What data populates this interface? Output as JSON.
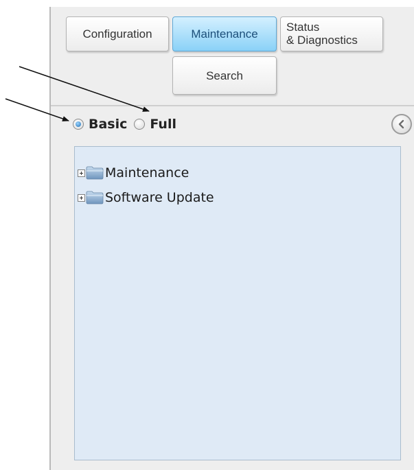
{
  "tabs": {
    "configuration": "Configuration",
    "maintenance": "Maintenance",
    "status_line1": "Status",
    "status_line2": "& Diagnostics",
    "search": "Search"
  },
  "view_mode": {
    "basic": "Basic",
    "full": "Full",
    "selected": "basic"
  },
  "tree": {
    "items": [
      {
        "label": "Maintenance",
        "icon": "folder-icon",
        "expander": "plus"
      },
      {
        "label": "Software Update",
        "icon": "folder-icon",
        "expander": "plus"
      }
    ]
  },
  "colors": {
    "active_tab": "#8ad1f7",
    "tree_background": "#dfeaf6",
    "panel_background": "#eeeeee"
  }
}
